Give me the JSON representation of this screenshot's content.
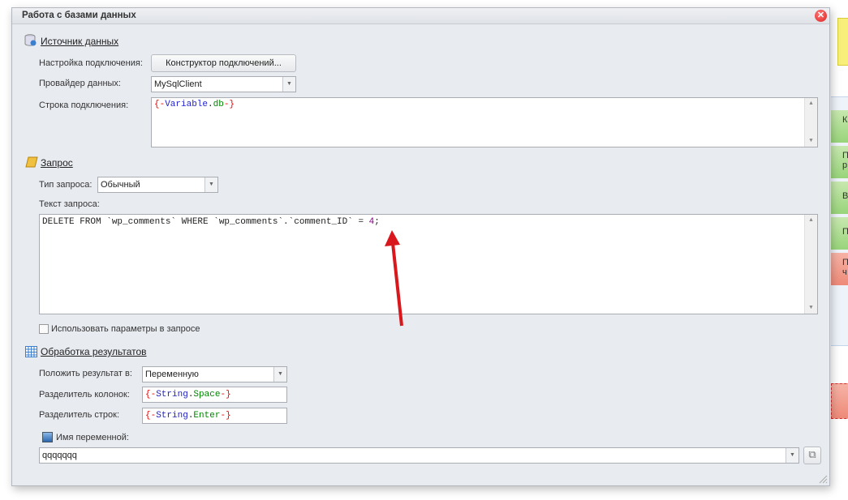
{
  "dialog": {
    "title": "Работа с базами данных"
  },
  "datasource": {
    "header": "Источник данных",
    "connection_settings_label": "Настройка подключения:",
    "connection_builder_button": "Конструктор подключений...",
    "provider_label": "Провайдер данных:",
    "provider_value": "MySqlClient",
    "connection_string_label": "Строка подключения:",
    "connection_string": {
      "open": "{-",
      "name": "Variable",
      "dot": ".",
      "field": "db",
      "close": "-}"
    }
  },
  "query": {
    "header": "Запрос",
    "type_label": "Тип запроса:",
    "type_value": "Обычный",
    "text_label": "Текст запроса:",
    "text_main": "DELETE FROM `wp_comments` WHERE `wp_comments`.`comment_ID` = ",
    "text_number": "4",
    "text_end": ";",
    "use_params_label": "Использовать параметры в запросе",
    "use_params_checked": false
  },
  "results": {
    "header": "Обработка результатов",
    "put_result_label": "Положить результат в:",
    "put_result_value": "Переменную",
    "col_sep_label": "Разделитель колонок:",
    "col_sep": {
      "open": "{-",
      "name": "String",
      "dot": ".",
      "field": "Space",
      "close": "-}"
    },
    "row_sep_label": "Разделитель строк:",
    "row_sep": {
      "open": "{-",
      "name": "String",
      "dot": ".",
      "field": "Enter",
      "close": "-}"
    },
    "var_name_label": "Имя переменной:",
    "var_name_value": "qqqqqqq"
  },
  "background": {
    "items": [
      {
        "text": "К р",
        "color": "green"
      },
      {
        "text": "П р",
        "color": "green"
      },
      {
        "text": "В",
        "color": "green"
      },
      {
        "text": "П",
        "color": "green"
      },
      {
        "text": "П ч",
        "color": "red"
      }
    ]
  },
  "colors": {
    "annotation_arrow": "#d8181c",
    "token_brace": "#e00000",
    "token_name": "#2222cc",
    "token_field": "#008800"
  }
}
